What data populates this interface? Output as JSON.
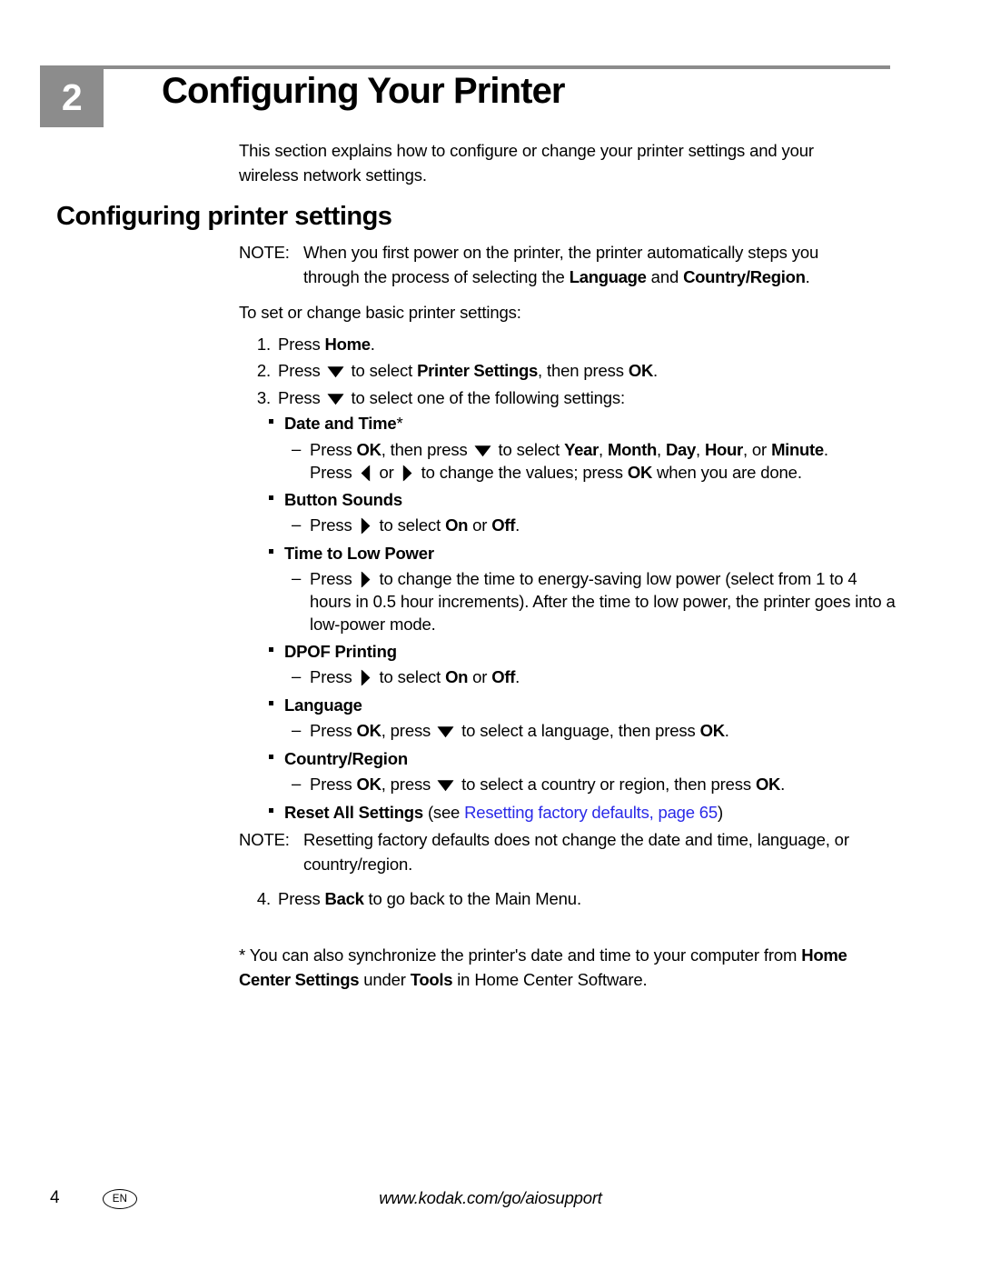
{
  "document": {
    "chapter_number": "2",
    "chapter_title": "Configuring Your Printer",
    "intro": "This section explains how to configure or change your printer settings and your wireless network settings.",
    "section_title": "Configuring printer settings"
  },
  "note_1": {
    "label": "NOTE:",
    "text_part_1": "When you first power on the printer, the printer automatically steps you through the process of selecting the ",
    "bold_1": "Language",
    "text_part_2": " and ",
    "bold_2": "Country/Region",
    "text_part_3": "."
  },
  "lead_in": "To set or change basic printer settings:",
  "steps": {
    "step1": {
      "num": "1.",
      "pre": "Press ",
      "bold": "Home",
      "post": "."
    },
    "step2": {
      "num": "2.",
      "pre": "Press ",
      "icon": "arrow-down-icon",
      "mid": " to select ",
      "bold": "Printer Settings",
      "mid2": ", then press ",
      "bold2": "OK",
      "post": "."
    },
    "step3": {
      "num": "3.",
      "pre": "Press ",
      "icon": "arrow-down-icon",
      "post": " to select one of the following settings:"
    },
    "step4": {
      "num": "4.",
      "pre": "Press ",
      "bold": "Back",
      "post": " to go back to the Main Menu."
    }
  },
  "settings": {
    "date_and_time": {
      "label": "Date and Time",
      "asterisk": "*",
      "detail_line1_a": "Press ",
      "detail_line1_b": "OK",
      "detail_line1_c": ", then press ",
      "detail_line1_d": " to select ",
      "opt1": "Year",
      "opt2": "Month",
      "opt3": "Day",
      "opt4": "Hour",
      "opt5": "Minute",
      "detail_line2_a": "Press ",
      "detail_line2_b": " or ",
      "detail_line2_c": " to change the values; press ",
      "detail_line2_d": "OK",
      "detail_line2_e": " when you are done."
    },
    "button_sounds": {
      "label": "Button Sounds",
      "detail_a": "Press ",
      "detail_b": " to select ",
      "on": "On",
      "or": " or ",
      "off": "Off",
      "detail_c": "."
    },
    "time_to_low_power": {
      "label": "Time to Low Power",
      "detail_a": "Press ",
      "detail_b": " to change the time to energy-saving low power (select from 1 to 4 hours in 0.5 hour increments). After the time to low power, the printer goes into a low-power mode."
    },
    "dpof_printing": {
      "label": "DPOF Printing",
      "detail_a": "Press ",
      "detail_b": " to select ",
      "on": "On",
      "or": " or ",
      "off": "Off",
      "detail_c": "."
    },
    "language": {
      "label": "Language",
      "detail_a": "Press ",
      "detail_b": "OK",
      "detail_c": ", press ",
      "detail_d": " to select a language, then press ",
      "detail_e": "OK",
      "detail_f": "."
    },
    "country_region": {
      "label": "Country/Region",
      "detail_a": "Press ",
      "detail_b": "OK",
      "detail_c": ", press ",
      "detail_d": " to select a country or region, then press ",
      "detail_e": "OK",
      "detail_f": "."
    },
    "reset_all_settings": {
      "label": "Reset All Settings",
      "pre": " (see ",
      "link": "Resetting factory defaults, page 65",
      "post": ")"
    }
  },
  "note_2": {
    "label": "NOTE:",
    "text": "Resetting factory defaults does not change the date and time, language, or country/region."
  },
  "footnote": {
    "part_1": "* You can also synchronize the printer's date and time to your computer from ",
    "bold_1": "Home Center Settings",
    "part_2": " under ",
    "bold_2": "Tools",
    "part_3": " in Home Center Software."
  },
  "footer": {
    "page_number": "4",
    "language_badge": "EN",
    "url": "www.kodak.com/go/aiosupport"
  },
  "colors": {
    "chapter_accent": "#8c8c8c",
    "link": "#2a2ae8",
    "text": "#000000"
  }
}
